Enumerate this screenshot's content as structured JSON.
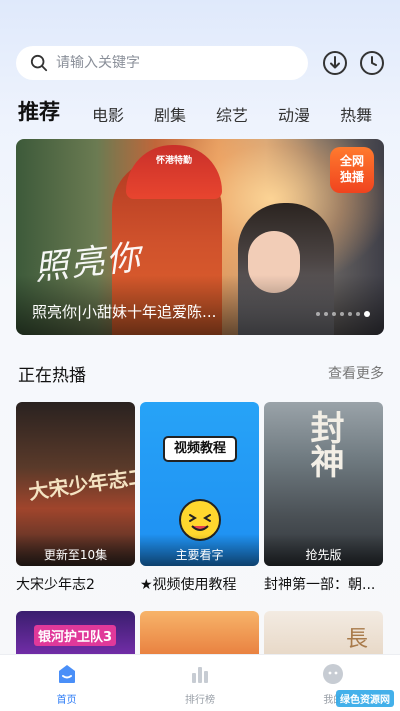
{
  "search": {
    "placeholder": "请输入关键字"
  },
  "header_icons": [
    "download-icon",
    "history-icon"
  ],
  "tabs": [
    {
      "label": "推荐",
      "active": true
    },
    {
      "label": "电影"
    },
    {
      "label": "剧集"
    },
    {
      "label": "综艺"
    },
    {
      "label": "动漫"
    },
    {
      "label": "热舞"
    }
  ],
  "banner": {
    "title_art": "照亮你",
    "helmet_text": "怀港特勤",
    "badge_line1": "全网",
    "badge_line2": "独播",
    "caption": "照亮你|小甜妹十年追爱陈...",
    "dot_count": 7,
    "active_dot": 7
  },
  "section": {
    "title": "正在热播",
    "more": "查看更多"
  },
  "cards": [
    {
      "title": "大宋少年志2",
      "badge": "更新至10集",
      "poster_text": "大宋少年志二"
    },
    {
      "title": "★视频使用教程",
      "badge": "主要看字",
      "poster_text": "视频教程"
    },
    {
      "title": "封神第一部：朝...",
      "badge": "抢先版",
      "poster_text": "封神"
    }
  ],
  "row2_texts": [
    "银河护卫队3",
    "",
    "長"
  ],
  "tabbar": [
    {
      "label": "首页",
      "icon": "home-icon",
      "active": true
    },
    {
      "label": "排行榜",
      "icon": "ranking-icon"
    },
    {
      "label": "我的",
      "icon": "profile-icon"
    }
  ],
  "watermark": "绿色资源网",
  "colors": {
    "accent": "#2d7cf6",
    "badge": "#f0431e"
  }
}
